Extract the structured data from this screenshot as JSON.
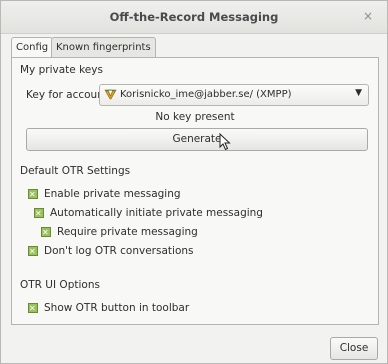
{
  "window": {
    "title": "Off-the-Record Messaging",
    "close_glyph": "×"
  },
  "tabs": [
    {
      "label": "Config",
      "active": true
    },
    {
      "label": "Known fingerprints",
      "active": false
    }
  ],
  "private_keys": {
    "section_title": "My private keys",
    "key_for_account_label": "Key for account:",
    "account_value": "Korisnicko_ime@jabber.se/ (XMPP)",
    "account_icon": "jabber-xmpp-icon",
    "status": "No key present",
    "generate_label": "Generate"
  },
  "default_settings": {
    "section_title": "Default OTR Settings",
    "options": [
      {
        "label": "Enable private messaging",
        "checked": true
      },
      {
        "label": "Automatically initiate private messaging",
        "checked": true
      },
      {
        "label": "Require private messaging",
        "checked": true
      },
      {
        "label": "Don't log OTR conversations",
        "checked": true
      }
    ]
  },
  "ui_options": {
    "section_title": "OTR UI Options",
    "options": [
      {
        "label": "Show OTR button in toolbar",
        "checked": true
      }
    ]
  },
  "footer": {
    "close_label": "Close"
  },
  "colors": {
    "checkbox": "#9bc25a",
    "background": "#f2f2f0"
  }
}
